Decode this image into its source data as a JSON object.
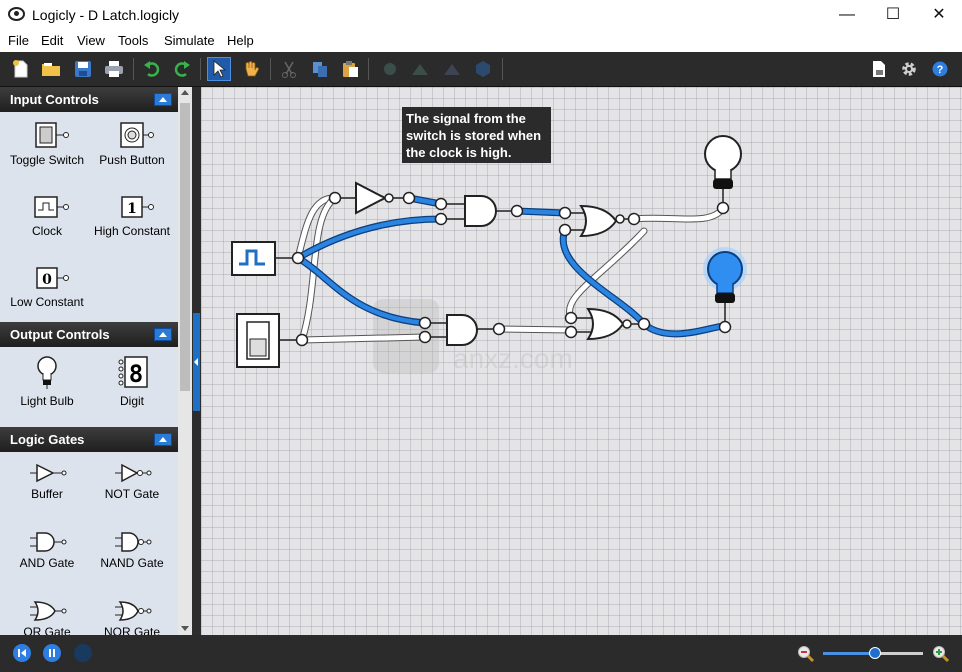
{
  "window": {
    "title": "Logicly - D Latch.logicly",
    "controls": {
      "minimize": "—",
      "maximize": "☐",
      "close": "✕"
    }
  },
  "menu": [
    "File",
    "Edit",
    "View",
    "Tools",
    "Simulate",
    "Help"
  ],
  "toolbar": {
    "left_icons": [
      "new-file-icon",
      "open-folder-icon",
      "save-icon",
      "print-icon",
      "undo-icon",
      "redo-icon",
      "select-pointer-icon",
      "pan-hand-icon",
      "cut-icon",
      "copy-icon",
      "paste-icon",
      "rotate-icon",
      "flip-icon",
      "align-icon",
      "group-icon"
    ],
    "right_icons": [
      "export-icon",
      "settings-icon",
      "help-icon"
    ],
    "accent_green": "#38b24a",
    "accent_blue": "#2e7de0"
  },
  "sidebar": {
    "sections": [
      {
        "title": "Input Controls",
        "items": [
          "Toggle Switch",
          "Push Button",
          "Clock",
          "High Constant",
          "Low Constant"
        ]
      },
      {
        "title": "Output Controls",
        "items": [
          "Light Bulb",
          "Digit"
        ]
      },
      {
        "title": "Logic Gates",
        "items": [
          "Buffer",
          "NOT Gate",
          "AND Gate",
          "NAND Gate",
          "OR Gate",
          "NOR Gate"
        ]
      }
    ],
    "constant_high": "1",
    "constant_low": "0",
    "digit_display": "8"
  },
  "canvas": {
    "note": "The signal from the switch is stored when the clock is high.",
    "watermark": "anxz.com",
    "wire_active_color": "#1f6fc5",
    "wire_inactive_color": "#ffffff",
    "bulb_on_color": "#2f8ef0"
  },
  "statusbar": {
    "zoom_level": 0.5,
    "icons": [
      "step-back-icon",
      "pause-icon",
      "record-icon",
      "zoom-out-icon",
      "zoom-in-icon"
    ]
  }
}
